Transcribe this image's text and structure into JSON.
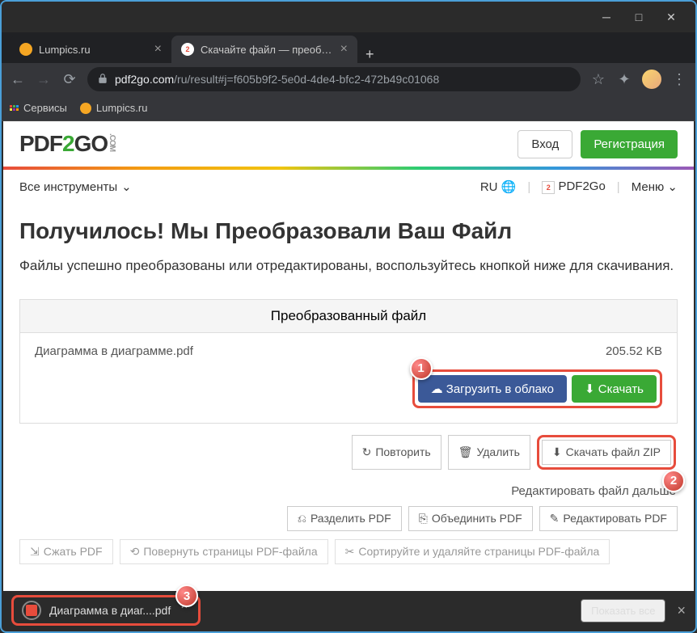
{
  "tabs": [
    {
      "title": "Lumpics.ru",
      "active": false
    },
    {
      "title": "Скачайте файл — преобразова",
      "active": true
    }
  ],
  "url": {
    "host": "pdf2go.com",
    "path": "/ru/result#j=f605b9f2-5e0d-4de4-bfc2-472b49c01068"
  },
  "bookmarks": {
    "services": "Сервисы",
    "lumpics": "Lumpics.ru"
  },
  "logo": {
    "p1": "PDF",
    "p2": "2",
    "p3": "GO",
    "p4": ".COM"
  },
  "auth": {
    "login": "Вход",
    "register": "Регистрация"
  },
  "toolbar": {
    "all_tools": "Все инструменты",
    "lang": "RU",
    "brand": "PDF2Go",
    "menu": "Меню"
  },
  "heading": "Получилось! Мы Преобразовали Ваш Файл",
  "subtitle": "Файлы успешно преобразованы или отредактированы, воспользуйтесь кнопкой ниже для скачивания.",
  "result": {
    "header": "Преобразованный файл",
    "filename": "Диаграмма в диаграмме.pdf",
    "filesize": "205.52 KB",
    "upload_cloud": "Загрузить в облако",
    "download": "Скачать",
    "retry": "Повторить",
    "delete": "Удалить",
    "download_zip": "Скачать файл ZIP",
    "edit_further": "Редактировать файл дальше",
    "split": "Разделить PDF",
    "merge": "Объединить PDF",
    "edit": "Редактировать PDF",
    "compress": "Сжать PDF",
    "rotate": "Повернуть страницы PDF-файла",
    "sort": "Сортируйте и удаляйте страницы PDF-файла"
  },
  "callouts": {
    "c1": "1",
    "c2": "2",
    "c3": "3"
  },
  "download_bar": {
    "filename": "Диаграмма в диаг....pdf",
    "show_all": "Показать все"
  }
}
